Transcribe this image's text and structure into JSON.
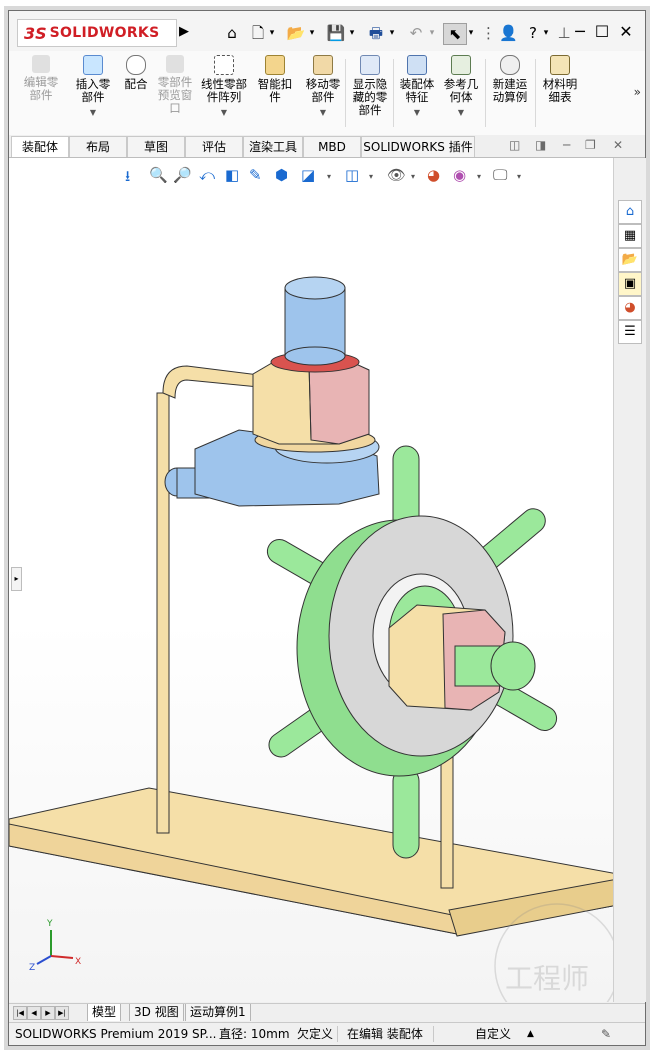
{
  "app": {
    "logo_ds": "3S",
    "logo_text": "SOLIDWORKS"
  },
  "title_bar": {
    "help": "?"
  },
  "ribbon": {
    "buttons": [
      {
        "label": "编辑零\n部件",
        "disabled": true
      },
      {
        "label": "插入零\n部件"
      },
      {
        "label": "配合"
      },
      {
        "label": "零部件\n预览窗\n口",
        "disabled": true
      },
      {
        "label": "线性零部\n件阵列"
      },
      {
        "label": "智能扣\n件"
      },
      {
        "label": "移动零\n部件"
      },
      {
        "label": "显示隐\n藏的零\n部件"
      },
      {
        "label": "装配体\n特征"
      },
      {
        "label": "参考几\n何体"
      },
      {
        "label": "新建运\n动算例"
      },
      {
        "label": "材料明\n细表"
      }
    ],
    "more": "»"
  },
  "tabs": [
    "装配体",
    "布局",
    "草图",
    "评估",
    "渲染工具",
    "MBD",
    "SOLIDWORKS 插件"
  ],
  "viewport": {
    "triad": {
      "x": "X",
      "y": "Y",
      "z": "Z"
    },
    "watermark": "工程师"
  },
  "bottom_tabs": [
    "模型",
    "3D 视图",
    "运动算例1"
  ],
  "status": {
    "product": "SOLIDWORKS Premium 2019 SP...",
    "diameter": "直径: 10mm",
    "constraint": "欠定义",
    "mode": "在编辑 装配体",
    "custom": "自定义",
    "custom_arrow": "▲"
  },
  "colors": {
    "logo_red": "#d01e25",
    "accent_blue": "#1a6ad0",
    "part_tan": "#f5dfa8",
    "part_blue": "#9ec4ec",
    "part_green": "#9be89b",
    "part_pink": "#e8b4b4"
  }
}
